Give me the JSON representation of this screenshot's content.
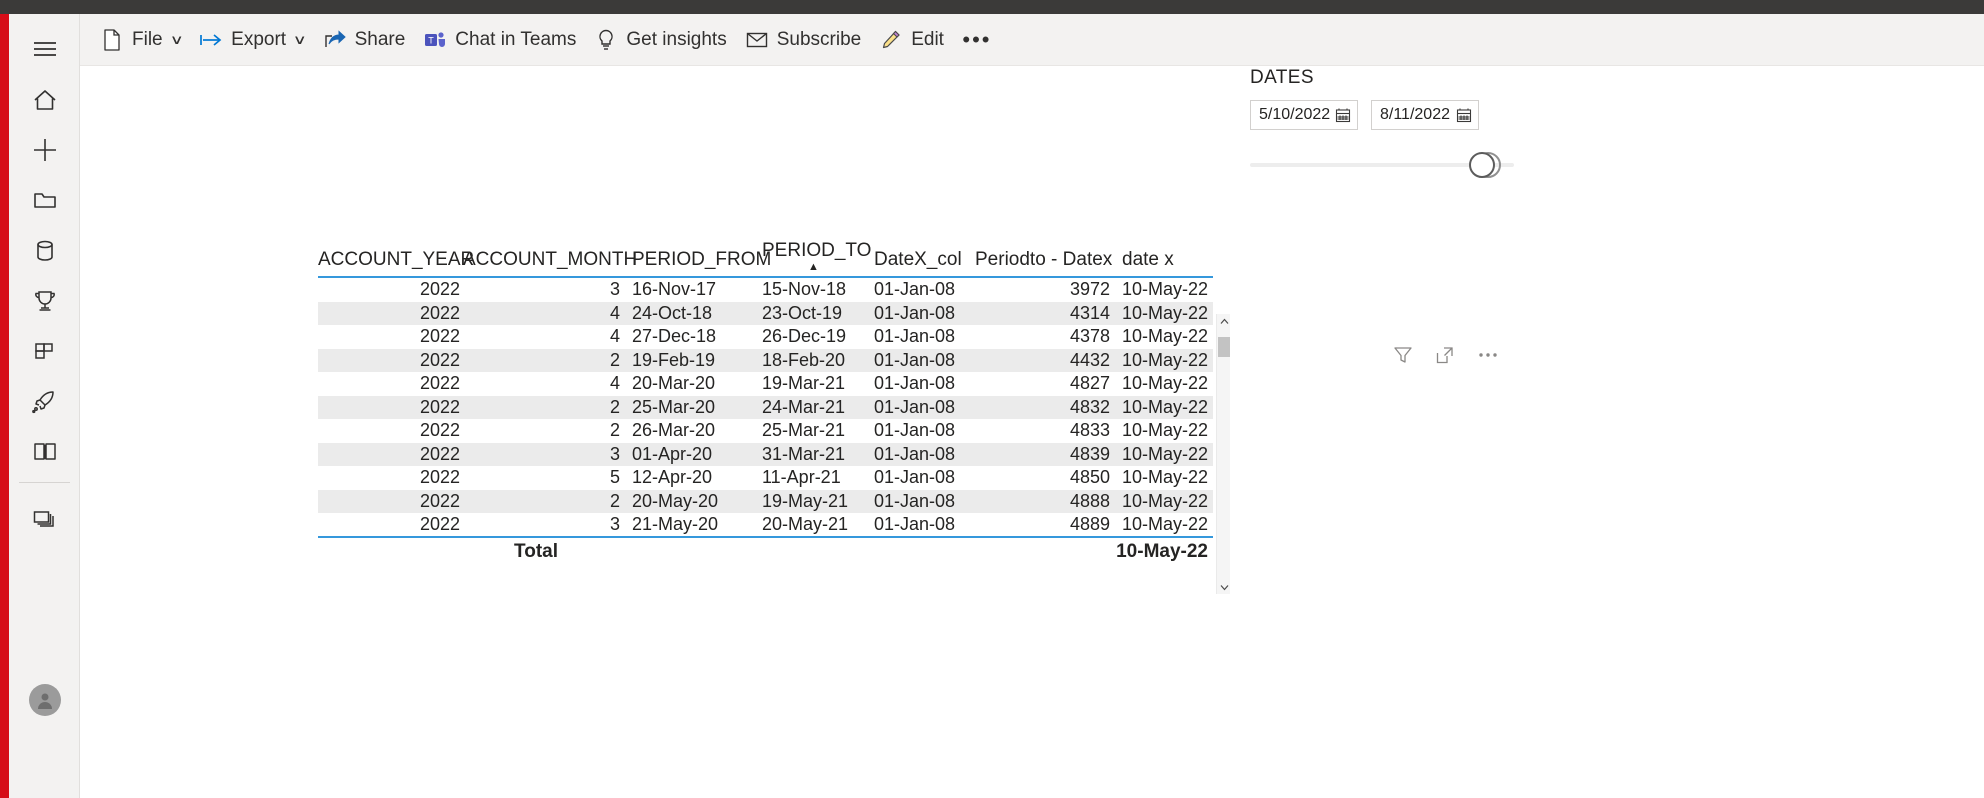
{
  "sidebar": {
    "items": [
      {
        "name": "hamburger-menu-icon",
        "label": "Navigation"
      },
      {
        "name": "home-icon",
        "label": "Home"
      },
      {
        "name": "plus-create-icon",
        "label": "Create"
      },
      {
        "name": "folder-browse-icon",
        "label": "Browse"
      },
      {
        "name": "database-datahub-icon",
        "label": "Data hub"
      },
      {
        "name": "trophy-metrics-icon",
        "label": "Metrics"
      },
      {
        "name": "apps-grid-icon",
        "label": "Apps"
      },
      {
        "name": "rocket-deployment-icon",
        "label": "Deployment pipelines"
      },
      {
        "name": "book-learn-icon",
        "label": "Learn"
      },
      {
        "name": "workspaces-icon",
        "label": "Workspaces"
      }
    ]
  },
  "toolbar": {
    "file_label": "File",
    "export_label": "Export",
    "share_label": "Share",
    "chat_in_teams_label": "Chat in Teams",
    "get_insights_label": "Get insights",
    "subscribe_label": "Subscribe",
    "edit_label": "Edit",
    "more_label": "•••",
    "caret": "∨"
  },
  "slicer": {
    "title": "DATES",
    "start_date": "5/10/2022",
    "end_date": "8/11/2022",
    "slider_position_pct": 92
  },
  "visual_actions": {
    "filter_label": "Filters",
    "focus_label": "Focus mode",
    "more_label": "More options"
  },
  "table": {
    "columns": [
      {
        "key": "account_year",
        "label": "ACCOUNT_YEAR",
        "align": "right",
        "sorted": false
      },
      {
        "key": "account_month",
        "label": "ACCOUNT_MONTH",
        "align": "right",
        "sorted": false
      },
      {
        "key": "period_from",
        "label": "PERIOD_FROM",
        "align": "left",
        "sorted": false
      },
      {
        "key": "period_to",
        "label": "PERIOD_TO",
        "align": "left",
        "sorted": true,
        "sort_direction": "asc",
        "sort_glyph": "▲"
      },
      {
        "key": "datex_col",
        "label": "DateX_col",
        "align": "left",
        "sorted": false
      },
      {
        "key": "periodto_datex",
        "label": "Periodto - Datex",
        "align": "right",
        "sorted": false
      },
      {
        "key": "date_x",
        "label": "date x",
        "align": "left",
        "sorted": false
      }
    ],
    "rows": [
      {
        "account_year": "2022",
        "account_month": "3",
        "period_from": "16-Nov-17",
        "period_to": "15-Nov-18",
        "datex_col": "01-Jan-08",
        "periodto_datex": "3972",
        "date_x": "10-May-22"
      },
      {
        "account_year": "2022",
        "account_month": "4",
        "period_from": "24-Oct-18",
        "period_to": "23-Oct-19",
        "datex_col": "01-Jan-08",
        "periodto_datex": "4314",
        "date_x": "10-May-22"
      },
      {
        "account_year": "2022",
        "account_month": "4",
        "period_from": "27-Dec-18",
        "period_to": "26-Dec-19",
        "datex_col": "01-Jan-08",
        "periodto_datex": "4378",
        "date_x": "10-May-22"
      },
      {
        "account_year": "2022",
        "account_month": "2",
        "period_from": "19-Feb-19",
        "period_to": "18-Feb-20",
        "datex_col": "01-Jan-08",
        "periodto_datex": "4432",
        "date_x": "10-May-22"
      },
      {
        "account_year": "2022",
        "account_month": "4",
        "period_from": "20-Mar-20",
        "period_to": "19-Mar-21",
        "datex_col": "01-Jan-08",
        "periodto_datex": "4827",
        "date_x": "10-May-22"
      },
      {
        "account_year": "2022",
        "account_month": "2",
        "period_from": "25-Mar-20",
        "period_to": "24-Mar-21",
        "datex_col": "01-Jan-08",
        "periodto_datex": "4832",
        "date_x": "10-May-22"
      },
      {
        "account_year": "2022",
        "account_month": "2",
        "period_from": "26-Mar-20",
        "period_to": "25-Mar-21",
        "datex_col": "01-Jan-08",
        "periodto_datex": "4833",
        "date_x": "10-May-22"
      },
      {
        "account_year": "2022",
        "account_month": "3",
        "period_from": "01-Apr-20",
        "period_to": "31-Mar-21",
        "datex_col": "01-Jan-08",
        "periodto_datex": "4839",
        "date_x": "10-May-22"
      },
      {
        "account_year": "2022",
        "account_month": "5",
        "period_from": "12-Apr-20",
        "period_to": "11-Apr-21",
        "datex_col": "01-Jan-08",
        "periodto_datex": "4850",
        "date_x": "10-May-22"
      },
      {
        "account_year": "2022",
        "account_month": "2",
        "period_from": "20-May-20",
        "period_to": "19-May-21",
        "datex_col": "01-Jan-08",
        "periodto_datex": "4888",
        "date_x": "10-May-22"
      },
      {
        "account_year": "2022",
        "account_month": "3",
        "period_from": "21-May-20",
        "period_to": "20-May-21",
        "datex_col": "01-Jan-08",
        "periodto_datex": "4889",
        "date_x": "10-May-22"
      }
    ],
    "total": {
      "label": "Total",
      "date_x": "10-May-22"
    }
  },
  "colors": {
    "brand_red": "#d60d18",
    "accent_blue": "#3598dc",
    "chrome_gray": "#f3f2f1",
    "top_strip": "#3b3a39",
    "alt_row": "#ebebeb",
    "text": "#252423"
  }
}
